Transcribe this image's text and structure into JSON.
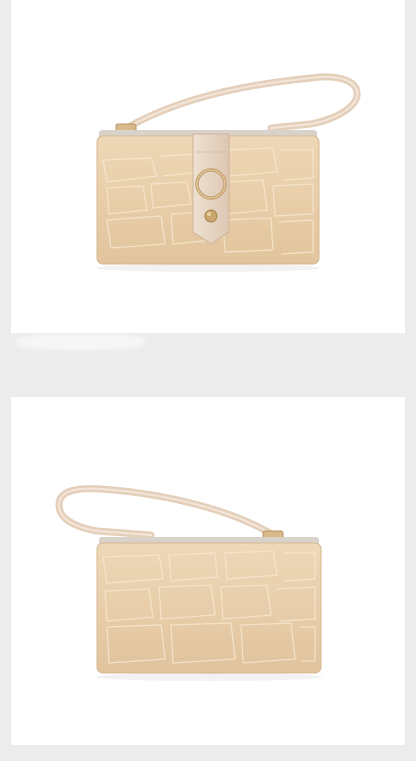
{
  "product": {
    "colors": {
      "leather": "#e9cfac",
      "leather_shade": "#d9bc97",
      "strap": "#e7d3bf",
      "zip": "#c9c4bd",
      "hardware": "#caa774",
      "background": "#ececec",
      "panel": "#ffffff"
    }
  },
  "views": [
    {
      "name": "front-view"
    },
    {
      "name": "back-view"
    }
  ]
}
